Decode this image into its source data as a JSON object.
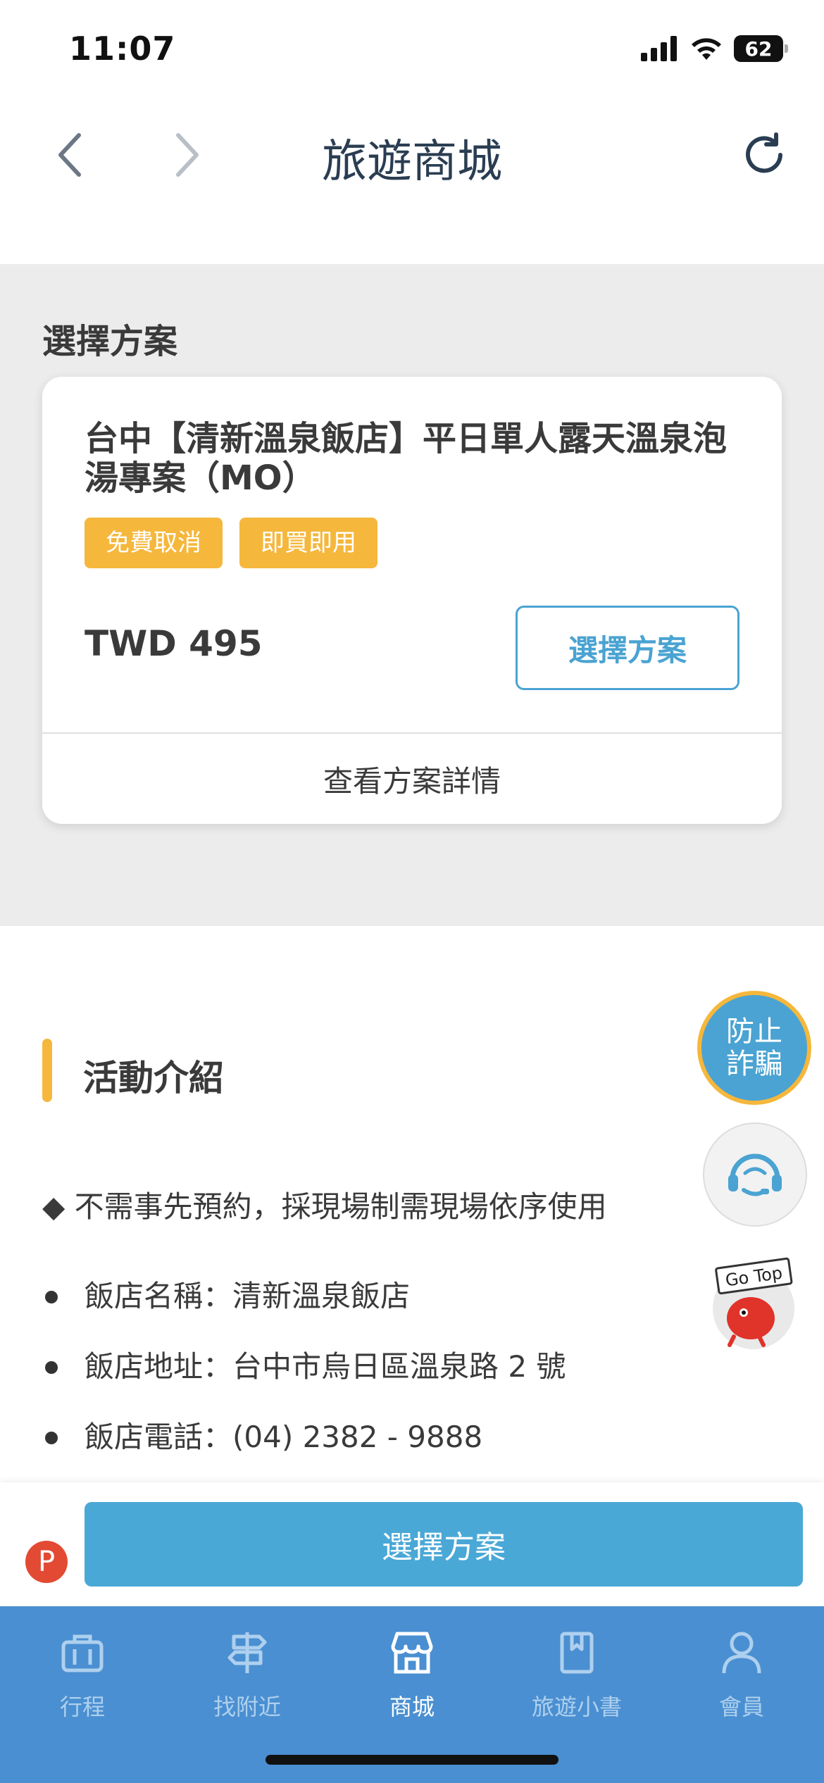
{
  "status_bar": {
    "time": "11:07",
    "battery": "62"
  },
  "header": {
    "title": "旅遊商城",
    "back_icon": "chevron-left-icon",
    "forward_icon": "chevron-right-icon",
    "refresh_icon": "refresh-icon"
  },
  "plan_section": {
    "title": "選擇方案",
    "card": {
      "name": "台中【清新溫泉飯店】平日單人露天溫泉泡湯專案（MO）",
      "tags": [
        "免費取消",
        "即買即用"
      ],
      "price": "TWD 495",
      "select_label": "選擇方案",
      "detail_label": "查看方案詳情"
    }
  },
  "intro": {
    "title": "活動介紹",
    "note": "◆ 不需事先預約，採現場制需現場依序使用",
    "items": [
      "飯店名稱：清新溫泉飯店",
      "飯店地址：台中市烏日區溫泉路 2 號",
      "飯店電話：(04) 2382 - 9888"
    ]
  },
  "floating": {
    "fraud_line1": "防止",
    "fraud_line2": "詐騙",
    "gotop_label": "Go Top"
  },
  "action_bar": {
    "badge": "P",
    "select_label": "選擇方案"
  },
  "tabs": [
    {
      "label": "行程",
      "icon": "briefcase-icon",
      "active": false
    },
    {
      "label": "找附近",
      "icon": "signpost-icon",
      "active": false
    },
    {
      "label": "商城",
      "icon": "store-icon",
      "active": true
    },
    {
      "label": "旅遊小書",
      "icon": "book-icon",
      "active": false
    },
    {
      "label": "會員",
      "icon": "user-icon",
      "active": false
    }
  ],
  "colors": {
    "accent_blue": "#4aa3d2",
    "tag_yellow": "#f5b73c",
    "tab_bar": "#4a8fd1",
    "badge_red": "#e24a33"
  }
}
